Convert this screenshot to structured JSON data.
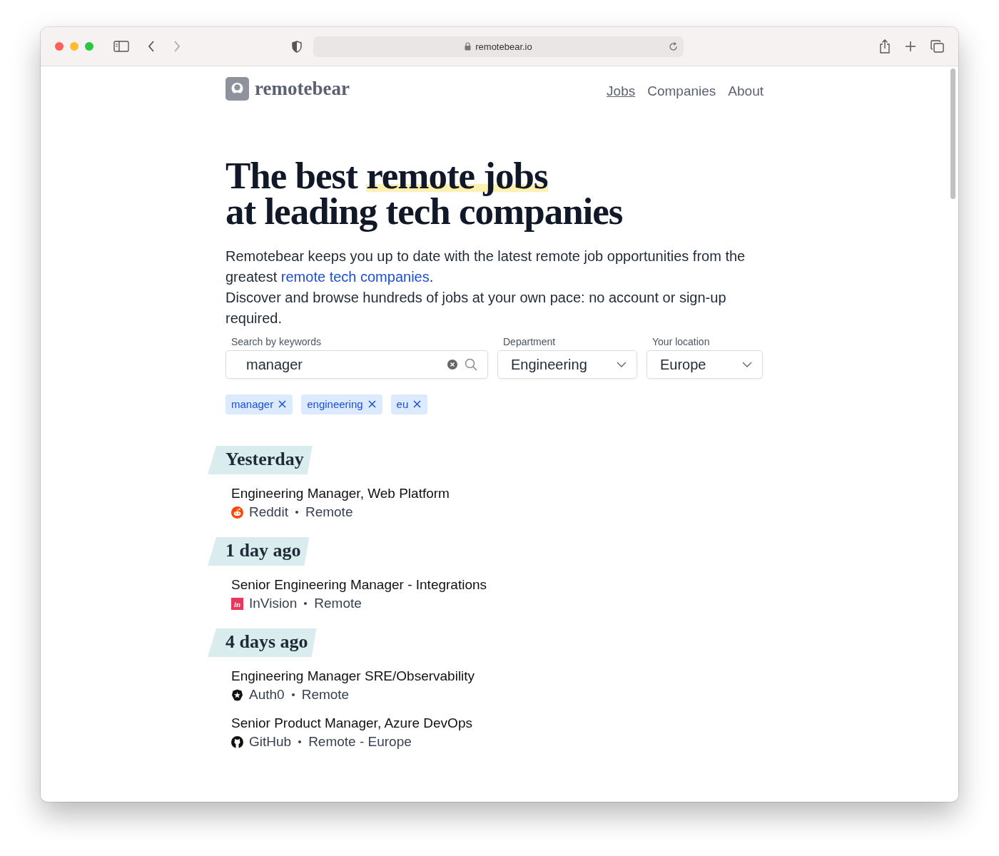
{
  "browser": {
    "url": "remotebear.io"
  },
  "site": {
    "logo_text": "remotebear",
    "nav": [
      {
        "label": "Jobs",
        "selected": true
      },
      {
        "label": "Companies",
        "selected": false
      },
      {
        "label": "About",
        "selected": false
      }
    ]
  },
  "hero": {
    "title_start": "The best",
    "title_highlight": "remote jobs",
    "title_line_2": "at leading tech companies",
    "intro_before_link": "Remotebear keeps you up to date with the latest remote job opportunities from the greatest",
    "intro_link": "remote tech companies",
    "intro_after_link": ".",
    "intro_2": "Discover and browse hundreds of jobs at your own pace: no account or sign-up required."
  },
  "filters": {
    "search": {
      "label": "Search by keywords",
      "value": "manager"
    },
    "department": {
      "label": "Department",
      "value": "Engineering"
    },
    "location": {
      "label": "Your location",
      "value": "Europe"
    },
    "tags": [
      "manager",
      "engineering",
      "eu"
    ]
  },
  "groups": [
    {
      "heading": "Yesterday",
      "jobs": [
        {
          "title": "Engineering Manager, Web Platform",
          "company": "Reddit",
          "kind": "reddit",
          "location": "Remote"
        }
      ]
    },
    {
      "heading": "1 day ago",
      "jobs": [
        {
          "title": "Senior Engineering Manager - Integrations",
          "company": "InVision",
          "kind": "invision",
          "logo_text": "in",
          "location": "Remote"
        }
      ]
    },
    {
      "heading": "4 days ago",
      "jobs": [
        {
          "title": "Engineering Manager SRE/Observability",
          "company": "Auth0",
          "kind": "auth0",
          "location": "Remote"
        },
        {
          "title": "Senior Product Manager, Azure DevOps",
          "company": "GitHub",
          "kind": "github",
          "location": "Remote - Europe"
        }
      ]
    }
  ]
}
